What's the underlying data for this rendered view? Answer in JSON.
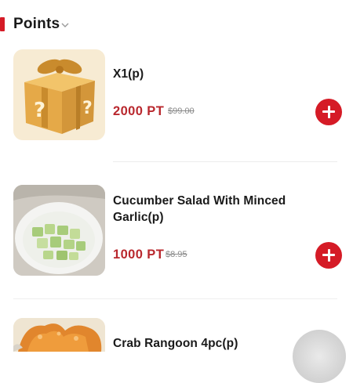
{
  "colors": {
    "accent": "#d51b26",
    "price": "#b9282e",
    "strike": "#8a8a8a",
    "gift_box": "#e9b04f",
    "ribbon": "#c98b2d",
    "gift_bg": "#f7ebd3"
  },
  "header": {
    "title": "Points",
    "dropdown_icon": "chevron-down-icon"
  },
  "items": [
    {
      "name": "X1(p)",
      "points": "2000 PT",
      "original_price": "$99.00",
      "image": "mystery-gift-box",
      "add_icon": "plus-icon"
    },
    {
      "name": "Cucumber Salad With Minced Garlic(p)",
      "points": "1000 PT",
      "original_price": "$8.95",
      "image": "cucumber-salad",
      "add_icon": "plus-icon"
    },
    {
      "name": "Crab Rangoon 4pc(p)",
      "image": "crab-rangoon"
    }
  ]
}
